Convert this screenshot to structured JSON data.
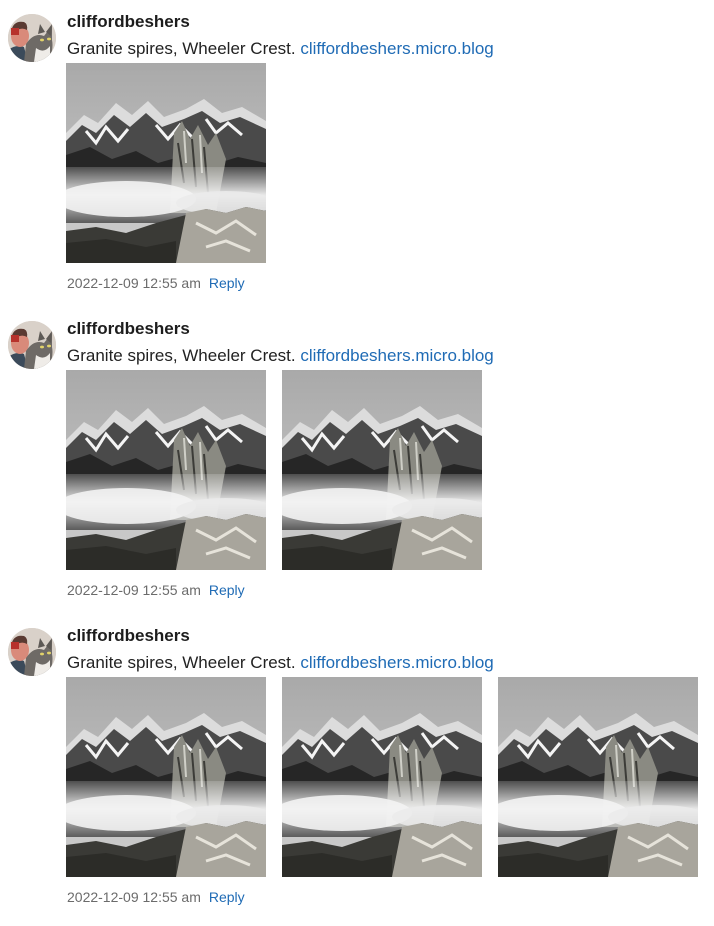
{
  "colors": {
    "link": "#1f6bb5",
    "text": "#222222",
    "meta": "#6b6b6b"
  },
  "posts": [
    {
      "avatar_icon": "user-avatar-with-cat",
      "username": "cliffordbeshers",
      "text": "Granite spires, Wheeler Crest.",
      "link_text": "cliffordbeshers.micro.blog",
      "photo_count": 1,
      "timestamp": "2022-12-09 12:55 am",
      "reply_label": "Reply"
    },
    {
      "avatar_icon": "user-avatar-with-cat",
      "username": "cliffordbeshers",
      "text": "Granite spires, Wheeler Crest.",
      "link_text": "cliffordbeshers.micro.blog",
      "photo_count": 2,
      "timestamp": "2022-12-09 12:55 am",
      "reply_label": "Reply"
    },
    {
      "avatar_icon": "user-avatar-with-cat",
      "username": "cliffordbeshers",
      "text": "Granite spires, Wheeler Crest.",
      "link_text": "cliffordbeshers.micro.blog",
      "photo_count": 3,
      "timestamp": "2022-12-09 12:55 am",
      "reply_label": "Reply"
    }
  ]
}
